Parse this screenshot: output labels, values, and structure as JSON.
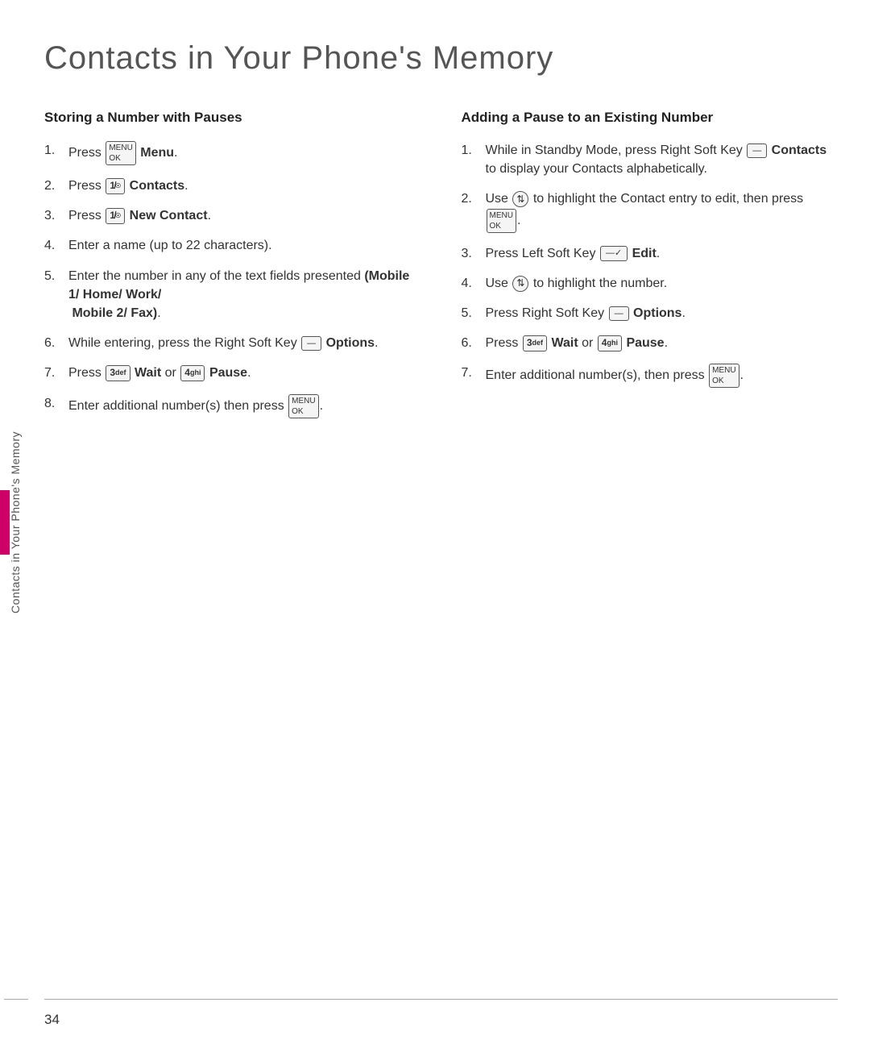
{
  "page": {
    "title": "Contacts in Your Phone's Memory",
    "page_number": "34"
  },
  "side_tab": {
    "label": "Contacts in Your Phone's Memory"
  },
  "left_section": {
    "heading": "Storing a Number with Pauses",
    "items": [
      {
        "number": "1.",
        "text_parts": [
          {
            "type": "text",
            "content": "Press "
          },
          {
            "type": "key_menu",
            "content": "MENU\nOK"
          },
          {
            "type": "text",
            "content": " "
          },
          {
            "type": "bold",
            "content": "Menu"
          },
          {
            "type": "text",
            "content": "."
          }
        ],
        "plain": "Press  Menu."
      },
      {
        "number": "2.",
        "text_parts": [
          {
            "type": "text",
            "content": "Press "
          },
          {
            "type": "key",
            "content": "1 ☻"
          },
          {
            "type": "text",
            "content": " "
          },
          {
            "type": "bold",
            "content": "Contacts"
          },
          {
            "type": "text",
            "content": "."
          }
        ],
        "plain": "Press  Contacts."
      },
      {
        "number": "3.",
        "text_parts": [
          {
            "type": "text",
            "content": "Press "
          },
          {
            "type": "key",
            "content": "1 ☻"
          },
          {
            "type": "text",
            "content": " "
          },
          {
            "type": "bold",
            "content": "New Contact"
          },
          {
            "type": "text",
            "content": "."
          }
        ],
        "plain": "Press  New Contact."
      },
      {
        "number": "4.",
        "plain": "Enter a name (up to 22 characters)."
      },
      {
        "number": "5.",
        "plain": "Enter the number in any of the text fields presented (Mobile 1/ Home/ Work/ Mobile 2/ Fax).",
        "has_bold_end": true,
        "bold_part": "(Mobile 1/ Home/ Work/ Mobile 2/ Fax)."
      },
      {
        "number": "6.",
        "plain": "While entering, press the Right Soft Key  — Options.",
        "has_soft_key": true
      },
      {
        "number": "7.",
        "plain": "Press  Wait or  Pause.",
        "has_keys_wait_pause": true
      },
      {
        "number": "8.",
        "plain": "Enter additional number(s) then press .",
        "has_menu_end": true
      }
    ]
  },
  "right_section": {
    "heading": "Adding a Pause to an Existing Number",
    "items": [
      {
        "number": "1.",
        "plain": "While in Standby Mode, press Right Soft Key  — Contacts to display your Contacts alphabetically.",
        "has_soft_key_contacts": true
      },
      {
        "number": "2.",
        "plain": "Use  to highlight the Contact entry to edit, then press .",
        "has_nav_and_menu": true
      },
      {
        "number": "3.",
        "plain": "Press Left Soft Key  — Edit.",
        "has_left_soft_key_edit": true
      },
      {
        "number": "4.",
        "plain": "Use  to highlight the number.",
        "has_nav": true
      },
      {
        "number": "5.",
        "plain": "Press Right Soft Key  — Options.",
        "has_right_soft_key_options": true
      },
      {
        "number": "6.",
        "plain": "Press  Wait or  Pause.",
        "has_keys_wait_pause": true
      },
      {
        "number": "7.",
        "plain": "Enter additional number(s), then press .",
        "has_menu_end": true
      }
    ]
  },
  "icons": {
    "menu_ok": "MENU\nOK",
    "key_1": "1 ☉",
    "key_3def": "3 def",
    "key_4ghi": "4 ghi",
    "soft_key_right": "—",
    "soft_key_left": "—✓",
    "nav_circle": "↕",
    "labels": {
      "menu": "Menu",
      "contacts": "Contacts",
      "new_contact": "New Contact",
      "options": "Options",
      "wait": "Wait",
      "pause": "Pause",
      "edit": "Edit"
    }
  }
}
